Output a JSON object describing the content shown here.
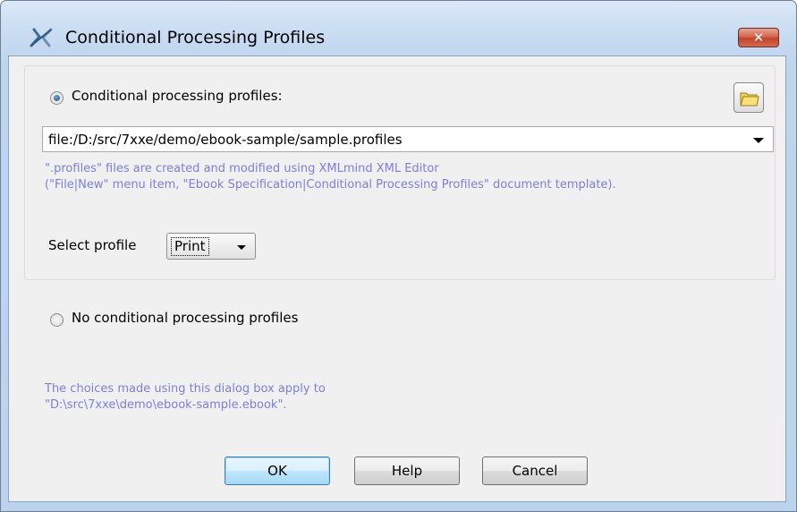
{
  "window": {
    "title": "Conditional Processing Profiles",
    "close_label": "✕",
    "accent_color": "#c0422a"
  },
  "profiles": {
    "radio_label": "Conditional processing profiles:",
    "selected": true,
    "folder_icon": "folder-icon",
    "combo_value": "file:/D:/src/7xxe/demo/ebook-sample/sample.profiles",
    "hint_line1": "\".profiles\" files are created and modified using XMLmind XML Editor",
    "hint_line2": "(\"File|New\" menu item, \"Ebook Specification|Conditional Processing Profiles\" document template).",
    "select_label": "Select profile",
    "select_value": "Print"
  },
  "no_profiles": {
    "radio_label": "No conditional processing profiles",
    "selected": false
  },
  "info": {
    "line1": "The choices made using this dialog box apply to",
    "line2": "\"D:\\src\\7xxe\\demo\\ebook-sample.ebook\"."
  },
  "buttons": {
    "ok": "OK",
    "help": "Help",
    "cancel": "Cancel"
  }
}
